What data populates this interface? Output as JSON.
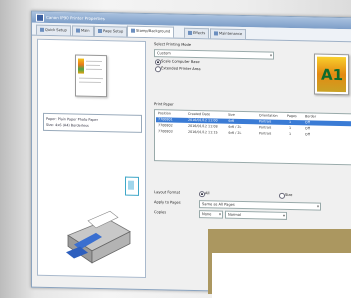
{
  "window": {
    "title": "Canon IP90 Printer Properties",
    "tabs": [
      {
        "label": "Quick Setup"
      },
      {
        "label": "Main"
      },
      {
        "label": "Page Setup"
      },
      {
        "label": "Stamp/Background"
      },
      {
        "label": "Effects"
      },
      {
        "label": "Maintenance"
      }
    ]
  },
  "left_panel": {
    "info_line1": "Paper: Plain Paper Photo Paper",
    "info_line2": "Size: 4x6 (A4) Borderless"
  },
  "preview_area": {
    "heading": "Select Printing Mode",
    "mode_value": "Custom",
    "radio1": "Scale Computer Base",
    "radio2": "Extended Printer Area",
    "thumb_text": "A1"
  },
  "table": {
    "title": "Print Paper",
    "headers": [
      "Position",
      "Created Date",
      "Size",
      "Orientation",
      "Pages",
      "Border"
    ],
    "rows": [
      [
        "7700801",
        "2016/01/12 11:00",
        "4x6",
        "Portrait",
        "1",
        "Off"
      ],
      [
        "7700802",
        "2016/01/12 11:08",
        "4x6 / 2L",
        "Portrait",
        "1",
        "Off"
      ],
      [
        "7700803",
        "2016/01/12 11:15",
        "4x6 / 2L",
        "Portrait",
        "1",
        "Off"
      ]
    ]
  },
  "bottom_options": {
    "row1_label": "Layout Format",
    "row1_opt1": "All",
    "row1_opt2": "Size",
    "row2_label": "Apply to Pages",
    "row2_value": "Same as All Pages",
    "row3_label": "Copies",
    "row3_value": "None",
    "row3_value2": "Normal"
  },
  "colors": {
    "selection": "#3a7bd5",
    "overlay": "#ab9760"
  }
}
